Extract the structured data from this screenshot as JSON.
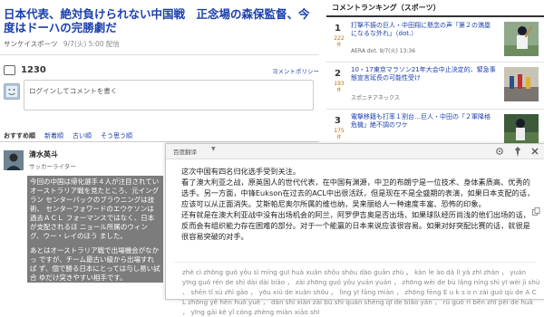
{
  "article": {
    "headline": "日本代表、絶対負けられない中国戦　正念場の森保監督、今度はドーハの完勝劇だ",
    "source": "サンケイスポーツ",
    "date": "9/7(火) 5:00 配信"
  },
  "comments": {
    "count": "1230",
    "policy_link": "ヨメントポリシー",
    "input_placeholder": "ログインしてコメントを書く",
    "tabs": [
      "おすすめ順",
      "新着順",
      "古い順",
      "そう思う順"
    ]
  },
  "commenter": {
    "name": "清水英斗",
    "role": "サッカーライター",
    "text_p1": "今回の中国は帰化選手４人が注目されてい オーストラリア戦を見たところ、元イングラン センターバックのブラウニングは技術、 センターフォワードのエウケソンは過去ＡＣＬ フォーマンスではなく、日本が支配されるほ ニョール所属のウィング、ウー・レイのほう ました。",
    "text_p2": "あとはオーストラリア戦で出場機会がなかっ ですが、チーム最古い級から出場すれば ず、個で勝る日本にとっては与し易い試合 ゆだけ突きやすい相手です。"
  },
  "ranking": {
    "title": "コメントランキング（スポーツ）",
    "items": [
      {
        "rank": "1",
        "count": "222",
        "unit": "件",
        "title": "打撃不振の巨人・中田翔に懸念の声「第２の満塁になるな外れ」（dot.）",
        "source": "AERA dot. 9/7(火) 13:36"
      },
      {
        "rank": "2",
        "count": "193",
        "unit": "件",
        "title": "10・17東京マラソン21年大会中止決定的、緊急事態宣言延長の可能性受け",
        "source": "スポニチアネックス"
      },
      {
        "rank": "3",
        "count": "175",
        "unit": "件",
        "title": "電撃移籍も打率１割台…巨人・中田の「２軍降格危機」絶不調のワケ",
        "source": ""
      }
    ]
  },
  "translator": {
    "label": "百度翻译",
    "caret": "▼",
    "cn_p1": "这次中国有四名归化选手受到关注。",
    "cn_p2": "看了澳大利亚之战，原英国人的世代代表，在中国有渊源，中卫的布朗宁是一位技术、身体素质高、优秀的选手。另一方面，中锋Eukson在过去的ACL中出很活跃，但是现在不是全盛期的表演，如果日本支配的话，应该可以从正面消失。艾斯帕尼奥尔所属的维也纳，吴来丽给人一种速度丰富、恐怖的印象。",
    "cn_p3": "还有就是在澳大利亚战中没有出场机会的阿兰，阿罗伊吉奥是否出场，如果球队经历尚浅的他们出场的话，反而会有组织能力存在困难的部分。对于一个能赢的日本来说应该很容易。如果对好突配比赛的话，就很是很容易突破的对手。",
    "pinyin": "zhè cì zhōng guó yǒu sì míng guī huà xuǎn shǒu shòu dào guān zhù 。 kàn le ào dà lì yà zhī zhàn ， yuán yīng guó rén de shì dài dài biǎo ， zài zhōng guó yǒu yuán yuán ， zhōng wèi de bù lǎng níng shì yī wèi jì shù 、 shēn tǐ sù zhì gāo ， yōu xiù de xuǎn shǒu 。 lìng yī fāng miàn ， zhōng fēng E u k s o n zài guò qù de A C L zhōng yě hěn huó yuè ， dàn shì xiàn zài bú shì quán shèng qī de biǎo yǎn ， rú guǒ rì běn zhī pèi de huà ， yīng gāi kě yǐ cóng zhèng miàn xiāo shī"
  }
}
